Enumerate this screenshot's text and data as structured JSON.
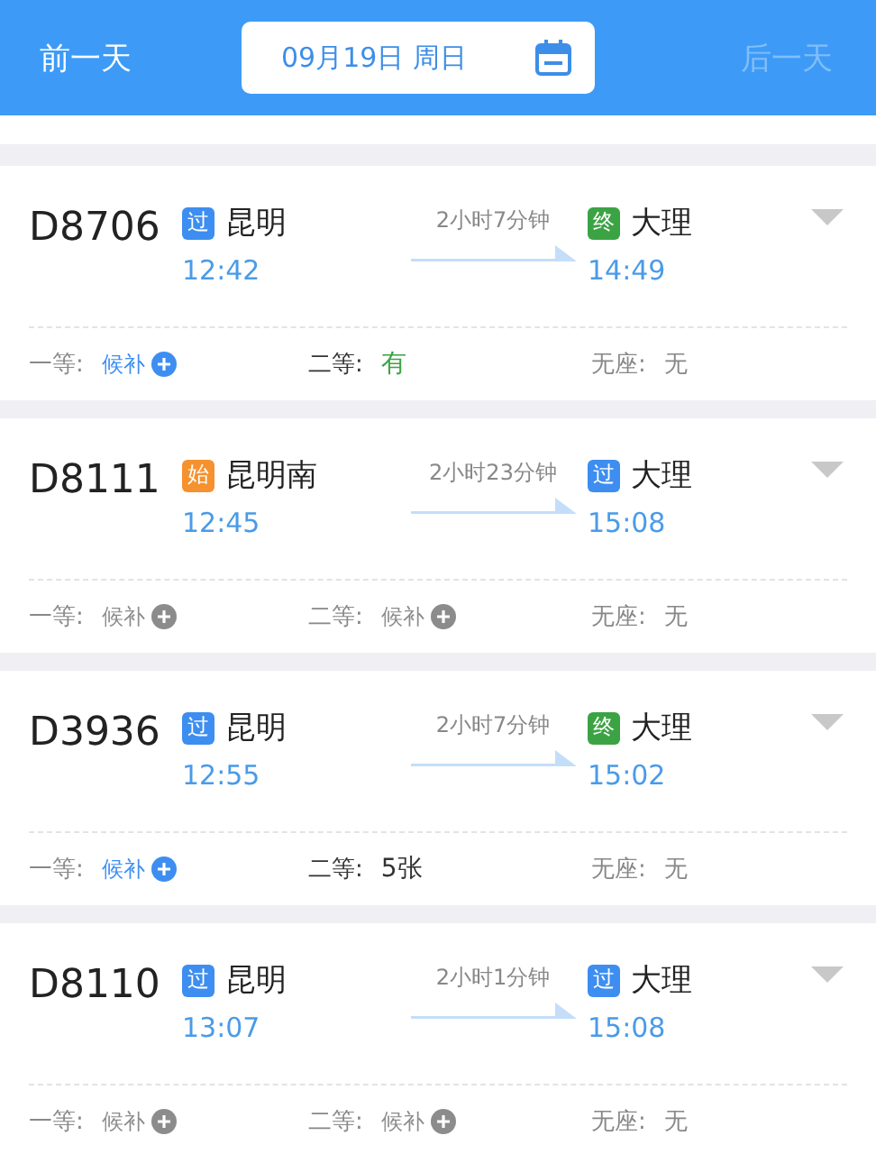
{
  "header": {
    "prev": {
      "label": "前一天",
      "disabled": false
    },
    "date": "09月19日 周日",
    "next": {
      "label": "后一天",
      "disabled": true
    }
  },
  "trains": [
    {
      "number": "D8706",
      "from": {
        "tag": "过",
        "kind": "pass",
        "name": "昆明",
        "time": "12:42"
      },
      "duration": "2小时7分钟",
      "to": {
        "tag": "终",
        "kind": "end",
        "name": "大理",
        "time": "14:49"
      },
      "seats": [
        {
          "label": "一等:",
          "value": "候补",
          "kind": "waitlist",
          "enabled": true
        },
        {
          "label": "二等:",
          "value": "有",
          "kind": "available"
        },
        {
          "label": "无座:",
          "value": "无",
          "kind": "none"
        }
      ]
    },
    {
      "number": "D8111",
      "from": {
        "tag": "始",
        "kind": "start",
        "name": "昆明南",
        "time": "12:45"
      },
      "duration": "2小时23分钟",
      "to": {
        "tag": "过",
        "kind": "pass",
        "name": "大理",
        "time": "15:08"
      },
      "seats": [
        {
          "label": "一等:",
          "value": "候补",
          "kind": "waitlist",
          "enabled": false
        },
        {
          "label": "二等:",
          "value": "候补",
          "kind": "waitlist",
          "enabled": false
        },
        {
          "label": "无座:",
          "value": "无",
          "kind": "none"
        }
      ]
    },
    {
      "number": "D3936",
      "from": {
        "tag": "过",
        "kind": "pass",
        "name": "昆明",
        "time": "12:55"
      },
      "duration": "2小时7分钟",
      "to": {
        "tag": "终",
        "kind": "end",
        "name": "大理",
        "time": "15:02"
      },
      "seats": [
        {
          "label": "一等:",
          "value": "候补",
          "kind": "waitlist",
          "enabled": true
        },
        {
          "label": "二等:",
          "value": "5张",
          "kind": "count"
        },
        {
          "label": "无座:",
          "value": "无",
          "kind": "none"
        }
      ]
    },
    {
      "number": "D8110",
      "from": {
        "tag": "过",
        "kind": "pass",
        "name": "昆明",
        "time": "13:07"
      },
      "duration": "2小时1分钟",
      "to": {
        "tag": "过",
        "kind": "pass",
        "name": "大理",
        "time": "15:08"
      },
      "seats": [
        {
          "label": "一等:",
          "value": "候补",
          "kind": "waitlist",
          "enabled": false
        },
        {
          "label": "二等:",
          "value": "候补",
          "kind": "waitlist",
          "enabled": false
        },
        {
          "label": "无座:",
          "value": "无",
          "kind": "none"
        }
      ]
    }
  ]
}
